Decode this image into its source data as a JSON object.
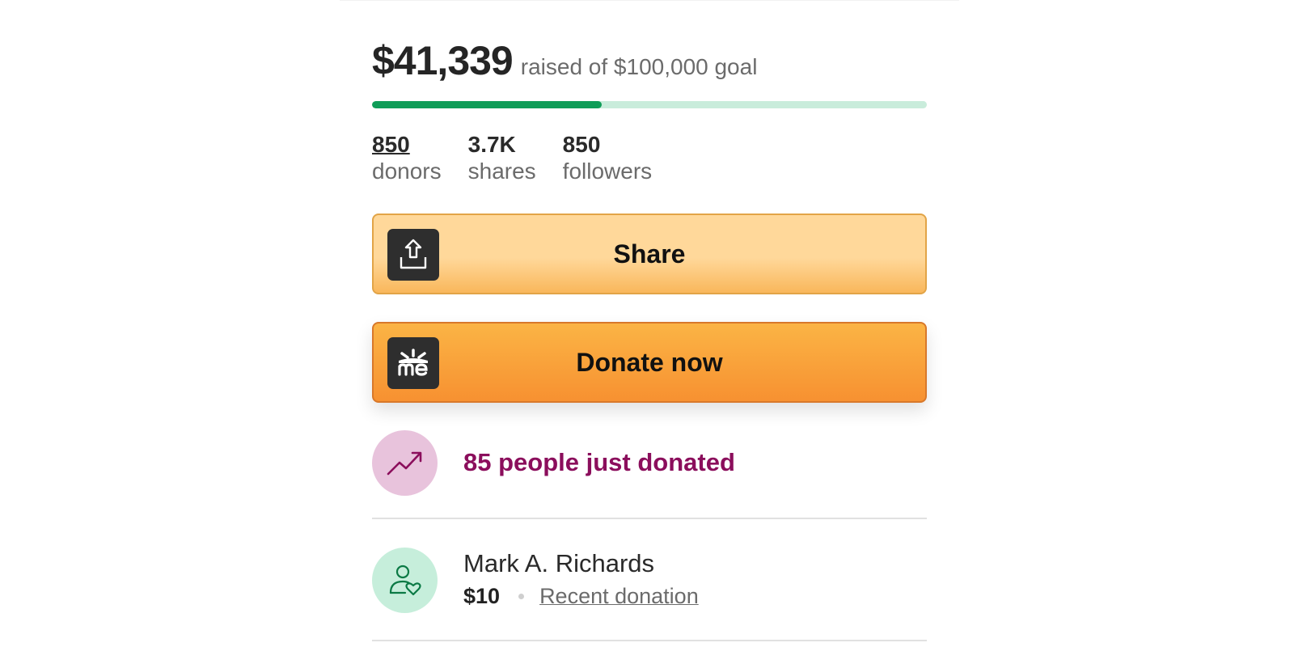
{
  "fundraiser": {
    "raised": "$41,339",
    "goal_caption": "raised of $100,000 goal",
    "progress_fraction": 0.41339
  },
  "stats": [
    {
      "value": "850",
      "label": "donors"
    },
    {
      "value": "3.7K",
      "label": "shares"
    },
    {
      "value": "850",
      "label": "followers"
    }
  ],
  "actions": {
    "share_label": "Share",
    "donate_label": "Donate now",
    "share_icon": "share-upload-icon",
    "donate_icon": "gofundme-logo-icon"
  },
  "activity": {
    "trend_text": "85 people just donated",
    "trend_icon": "trending-up-icon"
  },
  "recent_donation": {
    "name": "Mark A. Richards",
    "amount": "$10",
    "link_text": "Recent donation",
    "icon": "donor-heart-icon"
  },
  "colors": {
    "progress_fill": "#0f9d58",
    "progress_track": "#c9ecdb",
    "trend_text": "#8b0e5c",
    "share_button": "#ffd89a",
    "donate_button": "#f79131"
  }
}
